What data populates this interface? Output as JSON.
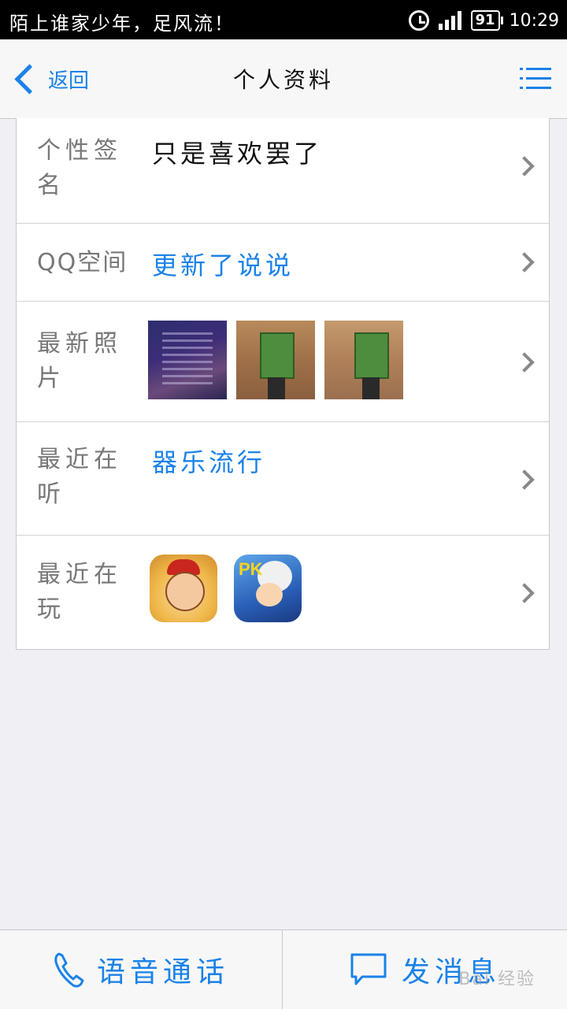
{
  "status_bar": {
    "carrier_text": "陌上谁家少年，足风流！",
    "battery": "91",
    "time": "10:29",
    "icons": [
      "alarm-icon",
      "signal-icon",
      "battery-icon"
    ]
  },
  "nav": {
    "back_label": "返回",
    "title": "个人资料",
    "menu_icon": "list-menu-icon"
  },
  "rows": [
    {
      "label": "个性签名",
      "value": "只是喜欢罢了",
      "value_style": "dark"
    },
    {
      "label": "QQ空间",
      "value": "更新了说说",
      "value_style": "link"
    },
    {
      "label": "最新照片",
      "value": "",
      "photos": [
        "photo-1",
        "photo-2",
        "photo-3"
      ]
    },
    {
      "label": "最近在听",
      "value": "器乐流行",
      "value_style": "link"
    },
    {
      "label": "最近在玩",
      "value": "",
      "apps": [
        "game-app-1",
        "game-app-2"
      ]
    }
  ],
  "bottom": {
    "voice_call_label": "语音通话",
    "send_message_label": "发消息",
    "voice_icon": "phone-icon",
    "message_icon": "chat-bubble-icon"
  },
  "watermark": "Bai 经验",
  "colors": {
    "accent": "#1a82e8",
    "background": "#efeff4",
    "status_bar": "#000000",
    "label_gray": "#777777"
  }
}
